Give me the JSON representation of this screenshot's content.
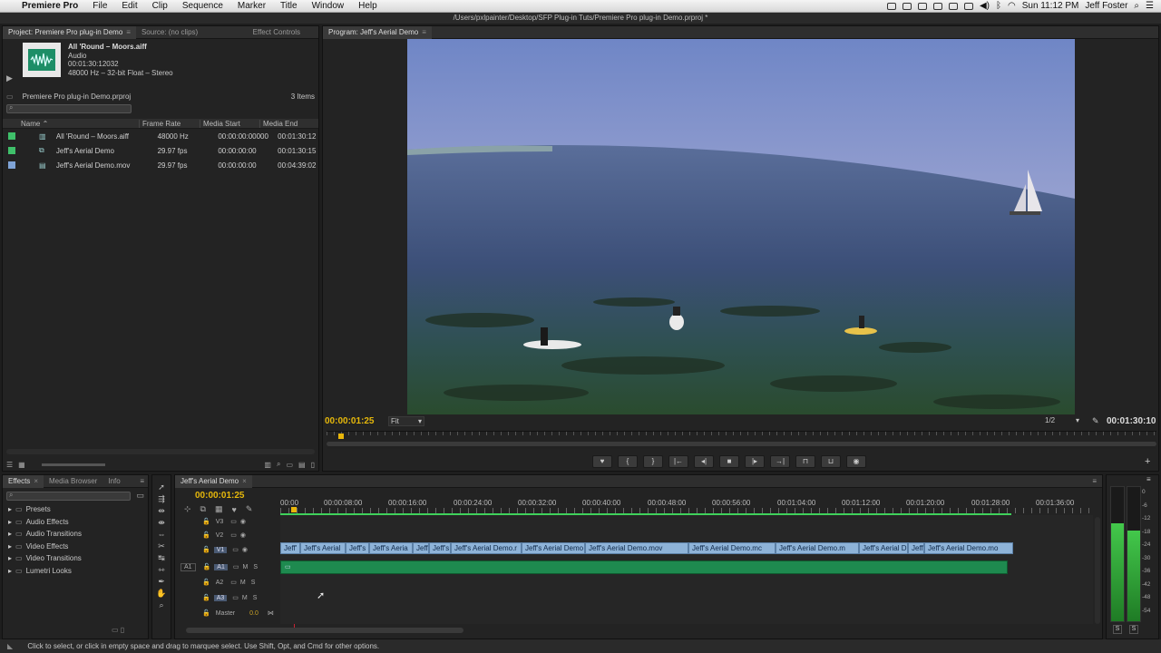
{
  "menubar": {
    "apple": "",
    "app": "Premiere Pro",
    "items": [
      "File",
      "Edit",
      "Clip",
      "Sequence",
      "Marker",
      "Title",
      "Window",
      "Help"
    ],
    "clock": "Sun 11:12 PM",
    "user": "Jeff Foster"
  },
  "doc_path": "/Users/pxlpainter/Desktop/SFP Plug-in Tuts/Premiere Pro plug-in Demo.prproj *",
  "project": {
    "tabs": [
      "Project: Premiere Pro plug-in Demo",
      "Source: (no clips)",
      "Effect Controls"
    ],
    "preview": {
      "name": "All 'Round – Moors.aiff",
      "type": "Audio",
      "duration": "00:01:30:12032",
      "format": "48000 Hz – 32-bit Float – Stereo"
    },
    "project_name": "Premiere Pro plug-in Demo.prproj",
    "item_count": "3 Items",
    "columns": [
      "Name",
      "Frame Rate",
      "Media Start",
      "Media End"
    ],
    "items": [
      {
        "name": "All 'Round – Moors.aiff",
        "rate": "48000 Hz",
        "start": "00:00:00:00000",
        "end": "00:01:30:12",
        "color": "#3fc06a"
      },
      {
        "name": "Jeff's Aerial Demo",
        "rate": "29.97 fps",
        "start": "00:00:00:00",
        "end": "00:01:30:15",
        "color": "#3fc06a"
      },
      {
        "name": "Jeff's Aerial Demo.mov",
        "rate": "29.97 fps",
        "start": "00:00:00:00",
        "end": "00:04:39:02",
        "color": "#7fa3d6"
      }
    ]
  },
  "program": {
    "tab": "Program: Jeff's Aerial Demo",
    "timecode": "00:00:01:25",
    "fit": "Fit",
    "resolution": "1/2",
    "duration": "00:01:30:10"
  },
  "effects": {
    "tabs": [
      "Effects",
      "Media Browser",
      "Info"
    ],
    "folders": [
      "Presets",
      "Audio Effects",
      "Audio Transitions",
      "Video Effects",
      "Video Transitions",
      "Lumetri Looks"
    ]
  },
  "timeline": {
    "tab": "Jeff's Aerial Demo",
    "timecode": "00:00:01:25",
    "ruler": [
      "00:00",
      "00:00:08:00",
      "00:00:16:00",
      "00:00:24:00",
      "00:00:32:00",
      "00:00:40:00",
      "00:00:48:00",
      "00:00:56:00",
      "00:01:04:00",
      "00:01:12:00",
      "00:01:20:00",
      "00:01:28:00",
      "00:01:36:00"
    ],
    "tracks": {
      "v3": "V3",
      "v2": "V2",
      "v1": "V1",
      "a1_src": "A1",
      "a1": "A1",
      "a2": "A2",
      "a3": "A3",
      "m": "M",
      "s": "S",
      "master": "Master",
      "master_val": "0.0"
    },
    "clips": [
      "Jeff'",
      "Jeff's Aerial",
      "Jeff's",
      "Jeff's Aeria",
      "Jeff",
      "Jeff's",
      "Jeff's Aerial Demo.r",
      "Jeff's Aerial Demo",
      "Jeff's Aerial Demo.mov",
      "Jeff's Aerial Demo.mc",
      "Jeff's Aerial Demo.m",
      "Jeff's Aerial D",
      "Jeff",
      "Jeff's Aerial Demo.mo"
    ]
  },
  "meter_scale": [
    "0",
    "-6",
    "-12",
    "-18",
    "-24",
    "-30",
    "-36",
    "-42",
    "-48",
    "-54"
  ],
  "meter_buttons": [
    "S",
    "S"
  ],
  "status": "Click to select, or click in empty space and drag to marquee select. Use Shift, Opt, and Cmd for other options."
}
